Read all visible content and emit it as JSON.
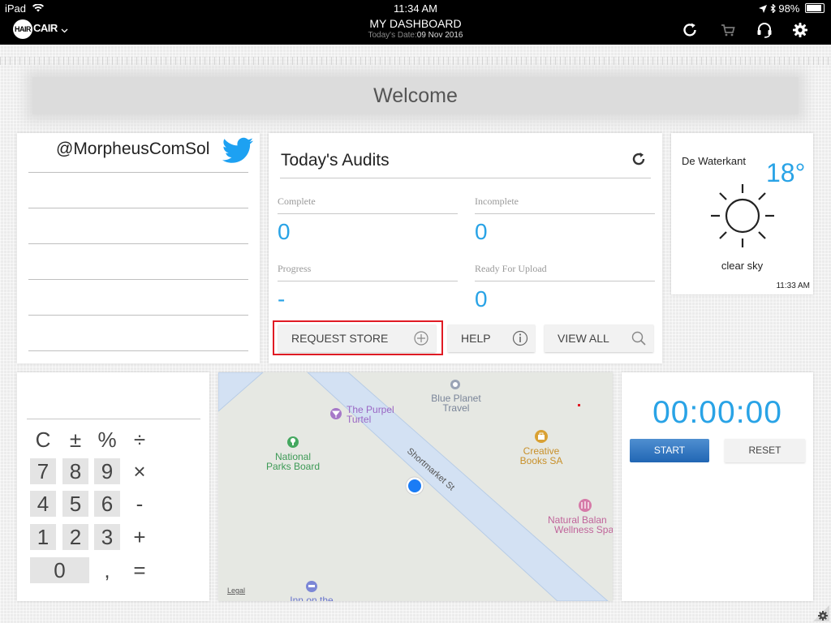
{
  "status_bar": {
    "device": "iPad",
    "time": "11:34 AM",
    "battery": "98%"
  },
  "nav": {
    "logo_hair": "HAIR",
    "logo_cair": "CAIR",
    "title": "MY DASHBOARD",
    "date_label": "Today's Date:",
    "date_value": "09 Nov 2016",
    "icons": [
      "refresh-icon",
      "cart-icon",
      "headset-icon",
      "gear-icon"
    ]
  },
  "welcome": "Welcome",
  "twitter": {
    "handle": "@MorpheusComSol"
  },
  "audits": {
    "title": "Today's Audits",
    "complete_label": "Complete",
    "complete_value": "0",
    "incomplete_label": "Incomplete",
    "incomplete_value": "0",
    "progress_label": "Progress",
    "progress_value": "-",
    "ready_label": "Ready For Upload",
    "ready_value": "0",
    "request_store_label": "REQUEST STORE",
    "help_label": "HELP",
    "view_all_label": "VIEW ALL"
  },
  "weather": {
    "location": "De Waterkant",
    "temperature": "18°",
    "condition": "clear sky",
    "time": "11:33 AM"
  },
  "calculator": {
    "rows": [
      [
        "C",
        "±",
        "%",
        "÷"
      ],
      [
        "7",
        "8",
        "9",
        "×"
      ],
      [
        "4",
        "5",
        "6",
        "-"
      ],
      [
        "1",
        "2",
        "3",
        "+"
      ],
      [
        "0",
        ",",
        "="
      ]
    ]
  },
  "map": {
    "street": "Shortmarket St",
    "places": {
      "purpel_1": "The Purpel",
      "purpel_2": "Turtel",
      "blue_1": "Blue Planet",
      "blue_2": "Travel",
      "national_1": "National",
      "national_2": "Parks Board",
      "creative_1": "Creative",
      "creative_2": "Books SA",
      "natural_1": "Natural Balan",
      "natural_2": "Wellness Spa",
      "inn": "Inn on the"
    },
    "legal": "Legal"
  },
  "stopwatch": {
    "display": "00:00:00",
    "start_label": "START",
    "reset_label": "RESET"
  },
  "colors": {
    "accent": "#29a3e6",
    "start_button": "#2e74c0",
    "highlight": "#e01b24",
    "twitter": "#1da1f2"
  }
}
